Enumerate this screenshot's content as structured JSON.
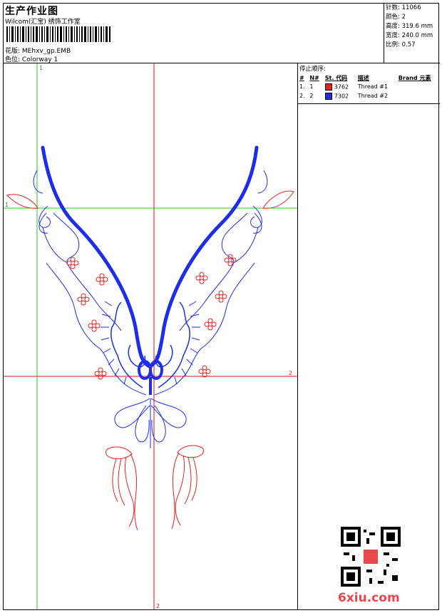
{
  "header": {
    "title": "生产作业图",
    "company": "Wilcom(汇宝) 绣饰工作室",
    "design_label": "花版:",
    "design_file": "MEhxv_gp.EMB",
    "colorway_label": "色位:",
    "colorway": "Colorway 1"
  },
  "specs": [
    {
      "label": "针数:",
      "value": "11066"
    },
    {
      "label": "颜色:",
      "value": "2"
    },
    {
      "label": "高度:",
      "value": "319.6 mm"
    },
    {
      "label": "宽度:",
      "value": "240.0 mm"
    },
    {
      "label": "比例:",
      "value": "0.57"
    }
  ],
  "stop_sequence": {
    "label": "停止顺序:",
    "columns": [
      "#",
      "N#",
      "St.",
      "代码",
      "描述",
      "Brand",
      "元素"
    ],
    "rows": [
      {
        "num": "1.",
        "n": "1",
        "code": "3762",
        "desc": "Thread #1",
        "color": "#e8201e"
      },
      {
        "num": "2.",
        "n": "2",
        "code": "7302",
        "desc": "Thread #2",
        "color": "#1e2ee8"
      }
    ]
  },
  "axis_labels": {
    "v_top": "1",
    "h_left": "1",
    "h_right": "2",
    "v_bottom": "2"
  },
  "watermark": "6xiu.com",
  "colors": {
    "red_thread": "#e8201e",
    "blue_thread": "#1e2ee8",
    "guide": "#22cc22",
    "axis": "#dd1111"
  }
}
